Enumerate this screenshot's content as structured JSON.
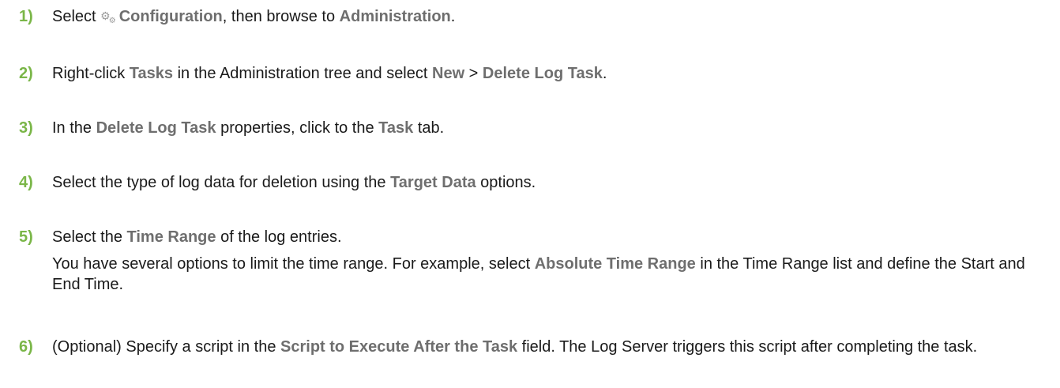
{
  "steps": [
    {
      "number": "1)",
      "parts": [
        {
          "t": "Select "
        },
        {
          "icon": "gear-icon"
        },
        {
          "b": "Configuration"
        },
        {
          "t": ", then browse to "
        },
        {
          "b": "Administration"
        },
        {
          "t": "."
        }
      ]
    },
    {
      "number": "2)",
      "parts": [
        {
          "t": "Right-click "
        },
        {
          "b": "Tasks"
        },
        {
          "t": " in the Administration tree and select "
        },
        {
          "b": "New"
        },
        {
          "t": " > "
        },
        {
          "b": "Delete Log Task"
        },
        {
          "t": "."
        }
      ]
    },
    {
      "number": "3)",
      "parts": [
        {
          "t": "In the "
        },
        {
          "b": "Delete Log Task"
        },
        {
          "t": " properties, click to the "
        },
        {
          "b": "Task"
        },
        {
          "t": " tab."
        }
      ]
    },
    {
      "number": "4)",
      "parts": [
        {
          "t": "Select the type of log data for deletion using the "
        },
        {
          "b": "Target Data"
        },
        {
          "t": " options."
        }
      ]
    },
    {
      "number": "5)",
      "parts": [
        {
          "t": "Select the "
        },
        {
          "b": "Time Range"
        },
        {
          "t": " of the log entries."
        }
      ],
      "sub_parts": [
        {
          "t": "You have several options to limit the time range. For example, select "
        },
        {
          "b": "Absolute Time Range"
        },
        {
          "t": " in the Time Range list and define the Start and End Time."
        }
      ]
    },
    {
      "number": "6)",
      "parts": [
        {
          "t": "(Optional) Specify a script in the "
        },
        {
          "b": "Script to Execute After the Task"
        },
        {
          "t": " field. The Log Server triggers this script after completing the task."
        }
      ]
    }
  ],
  "colors": {
    "step_number": "#7ab648",
    "ui_term": "#6e6e6e",
    "body_text": "#1a1a1a"
  }
}
